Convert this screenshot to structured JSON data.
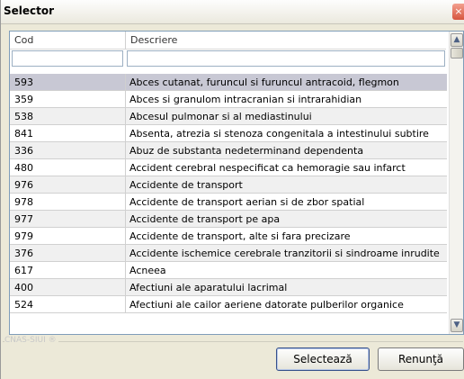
{
  "window": {
    "title": "Selector",
    "close_label": "×"
  },
  "grid": {
    "columns": [
      "Cod",
      "Descriere"
    ],
    "filters": {
      "cod": "",
      "descriere": ""
    },
    "rows": [
      {
        "cod": "593",
        "descriere": "Abces cutanat, furuncul si furuncul antracoid, flegmon",
        "selected": true
      },
      {
        "cod": "359",
        "descriere": "Abces si granulom intracranian si intrarahidian"
      },
      {
        "cod": "538",
        "descriere": "Abcesul pulmonar si al mediastinului"
      },
      {
        "cod": "841",
        "descriere": "Absenta, atrezia si stenoza congenitala a intestinului subtire"
      },
      {
        "cod": "336",
        "descriere": "Abuz de substanta nedeterminand dependenta"
      },
      {
        "cod": "480",
        "descriere": "Accident cerebral nespecificat ca hemoragie sau infarct"
      },
      {
        "cod": "976",
        "descriere": "Accidente de transport"
      },
      {
        "cod": "978",
        "descriere": "Accidente de transport aerian si de zbor spatial"
      },
      {
        "cod": "977",
        "descriere": "Accidente de transport pe apa"
      },
      {
        "cod": "979",
        "descriere": "Accidente de transport, alte si fara precizare"
      },
      {
        "cod": "376",
        "descriere": "Accidente ischemice cerebrale tranzitorii si sindroame inrudite"
      },
      {
        "cod": "617",
        "descriere": "Acneea"
      },
      {
        "cod": "400",
        "descriere": "Afectiuni ale aparatului lacrimal"
      },
      {
        "cod": "524",
        "descriere": "Afectiuni ale cailor aeriene datorate pulberilor organice"
      }
    ]
  },
  "footer": {
    "brand": "CNAS-SIUI ®",
    "select_label": "Selectează",
    "cancel_label": "Renunţă"
  }
}
